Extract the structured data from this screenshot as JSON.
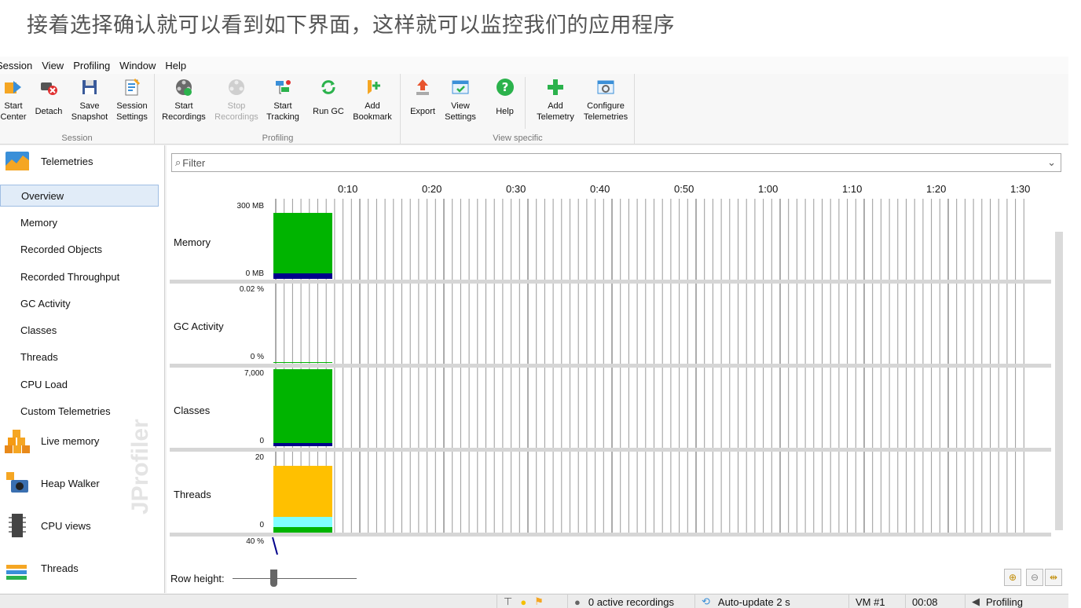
{
  "caption": "接着选择确认就可以看到如下界面，这样就可以监控我们的应用程序",
  "menu": [
    "Session",
    "View",
    "Profiling",
    "Window",
    "Help"
  ],
  "ribbon": {
    "groups": {
      "session": "Session",
      "profiling": "Profiling",
      "view_specific": "View specific"
    },
    "buttons": {
      "start_center": [
        "Start",
        "Center"
      ],
      "detach": [
        "Detach"
      ],
      "save_snapshot": [
        "Save",
        "Snapshot"
      ],
      "session_settings": [
        "Session",
        "Settings"
      ],
      "start_recordings": [
        "Start",
        "Recordings"
      ],
      "stop_recordings": [
        "Stop",
        "Recordings"
      ],
      "start_tracking": [
        "Start",
        "Tracking"
      ],
      "run_gc": [
        "Run GC"
      ],
      "add_bookmark": [
        "Add",
        "Bookmark"
      ],
      "export": [
        "Export"
      ],
      "view_settings": [
        "View",
        "Settings"
      ],
      "help": [
        "Help"
      ],
      "add_telemetry": [
        "Add",
        "Telemetry"
      ],
      "configure_telemetries": [
        "Configure",
        "Telemetries"
      ]
    }
  },
  "sidebar": {
    "telemetries": "Telemetries",
    "items": [
      "Overview",
      "Memory",
      "Recorded Objects",
      "Recorded Throughput",
      "GC Activity",
      "Classes",
      "Threads",
      "CPU Load",
      "Custom Telemetries"
    ],
    "active": "Overview",
    "sections": [
      "Live memory",
      "Heap Walker",
      "CPU views",
      "Threads"
    ],
    "brand": "JProfiler"
  },
  "filter": {
    "placeholder": "Filter"
  },
  "timeline": {
    "ticks": [
      "0:10",
      "0:20",
      "0:30",
      "0:40",
      "0:50",
      "1:00",
      "1:10",
      "1:20",
      "1:30"
    ]
  },
  "rows": [
    {
      "name": "Memory",
      "max": "300 MB",
      "min": "0 MB"
    },
    {
      "name": "GC Activity",
      "max": "0.02 %",
      "min": "0 %"
    },
    {
      "name": "Classes",
      "max": "7,000",
      "min": "0"
    },
    {
      "name": "Threads",
      "max": "20",
      "min": "0"
    }
  ],
  "partial_row": {
    "max": "40 %"
  },
  "row_height_label": "Row height:",
  "status": {
    "recordings": "0 active recordings",
    "autoupdate": "Auto-update 2 s",
    "vm": "VM #1",
    "time": "00:08",
    "mode": "Profiling"
  },
  "colors": {
    "green": "#00b400",
    "navy": "#00008b",
    "amber": "#ffc000",
    "cyan": "#7fffff",
    "accent": "#9fbde3"
  }
}
